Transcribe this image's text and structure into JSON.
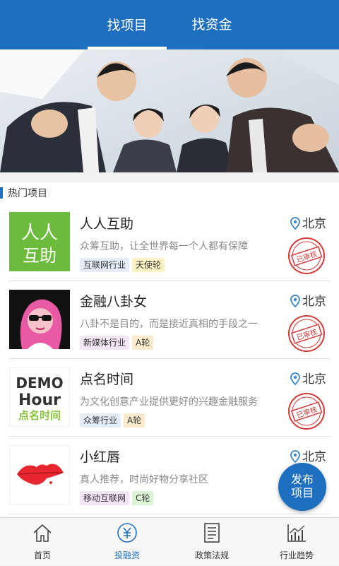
{
  "tabs": [
    {
      "label": "找项目",
      "active": true
    },
    {
      "label": "找资金",
      "active": false
    }
  ],
  "section": {
    "title": "热门项目"
  },
  "projects": [
    {
      "name": "人人互助",
      "desc": "众筹互助，让全世界每一个人都有保障",
      "location": "北京",
      "tags": [
        "互联网行业",
        "天使轮"
      ],
      "logo_text": [
        "人人",
        "互助"
      ],
      "stamp": "已审核"
    },
    {
      "name": "金融八卦女",
      "desc": "八卦不是目的，而是接近真相的手段之一",
      "location": "北京",
      "tags": [
        "新媒体行业",
        "A轮"
      ],
      "stamp": "已审核"
    },
    {
      "name": "点名时间",
      "desc": "为文化创意产业提供更好的兴趣金融服务",
      "location": "北京",
      "tags": [
        "众筹行业",
        "A轮"
      ],
      "logo_text": [
        "DEMO",
        "Hour",
        "点名时间"
      ],
      "stamp": "已审核"
    },
    {
      "name": "小红唇",
      "desc": "真人推荐，时尚好物分享社区",
      "location": "北京",
      "tags": [
        "移动互联网",
        "C轮"
      ]
    }
  ],
  "fab": {
    "line1": "发布",
    "line2": "项目"
  },
  "bottom_nav": [
    {
      "label": "首页",
      "icon": "home-icon",
      "active": false
    },
    {
      "label": "投融资",
      "icon": "yuan-icon",
      "active": true
    },
    {
      "label": "政策法规",
      "icon": "document-icon",
      "active": false
    },
    {
      "label": "行业趋势",
      "icon": "chart-icon",
      "active": false
    }
  ],
  "colors": {
    "primary": "#1e6fc0",
    "stamp_red": "#d23a3a"
  }
}
